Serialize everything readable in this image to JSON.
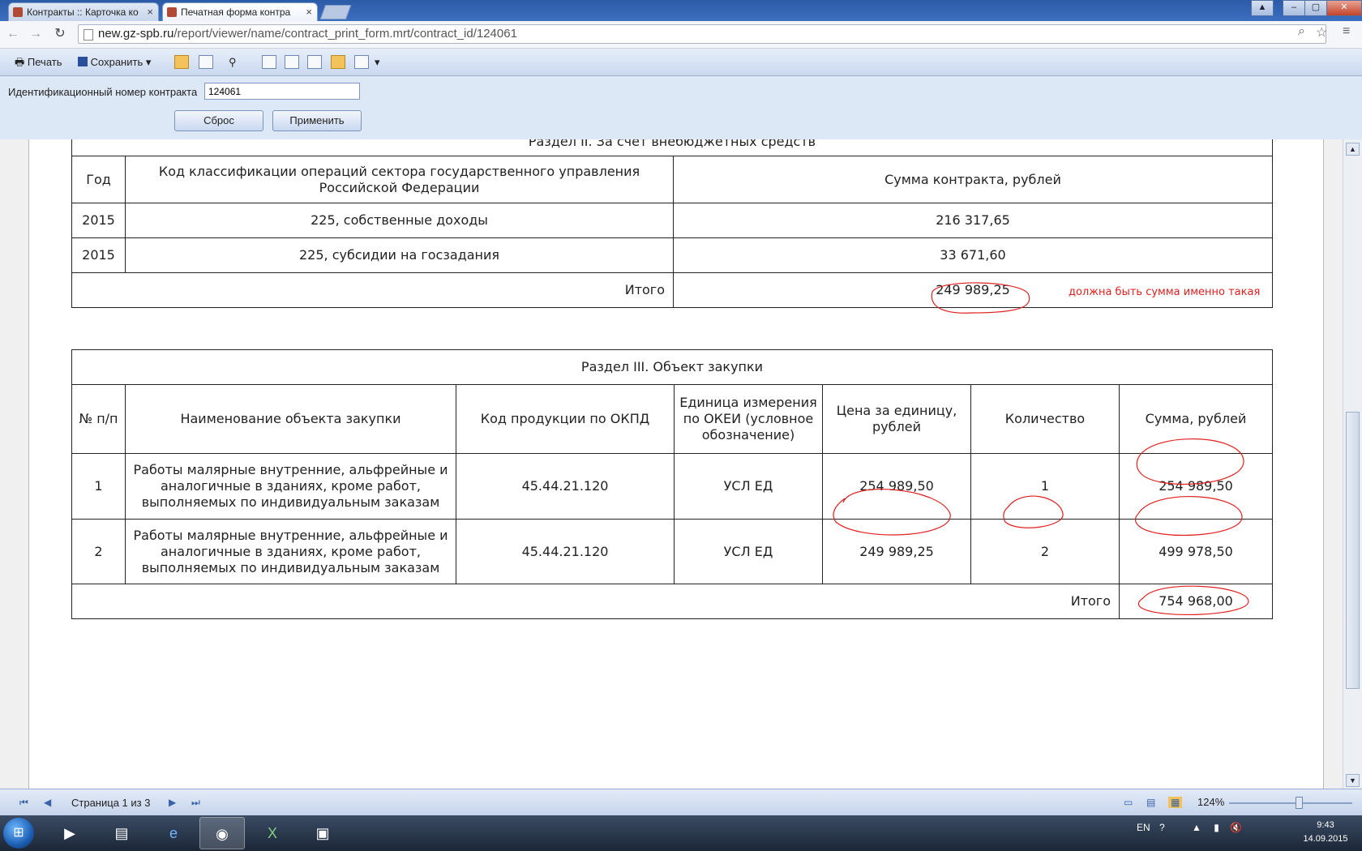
{
  "browser": {
    "tabs": [
      {
        "label": "Контракты :: Карточка ко"
      },
      {
        "label": "Печатная форма контра"
      }
    ],
    "url_host": "new.gz-spb.ru",
    "url_path": "/report/viewer/name/contract_print_form.mrt/contract_id/124061"
  },
  "toolbar": {
    "print_label": "Печать",
    "save_label": "Сохранить"
  },
  "params": {
    "label": "Идентификационный номер контракта",
    "value": "124061",
    "reset_label": "Сброс",
    "apply_label": "Применить"
  },
  "report": {
    "section2": {
      "title_fragment": "Раздел II. За счет внебюджетных средств",
      "headers": [
        "Год",
        "Код классификации операций сектора государственного управления Российской Федерации",
        "Сумма контракта, рублей"
      ],
      "rows": [
        [
          "2015",
          "225, собственные доходы",
          "216 317,65"
        ],
        [
          "2015",
          "225, субсидии на госзадания",
          "33 671,60"
        ]
      ],
      "total_label": "Итого",
      "total_value": "249 989,25"
    },
    "annotation": "должна быть сумма именно такая",
    "section3": {
      "title": "Раздел III. Объект закупки",
      "headers": [
        "№ п/п",
        "Наименование объекта закупки",
        "Код продукции по ОКПД",
        "Единица измерения по ОКЕИ (условное обозначение)",
        "Цена за единицу, рублей",
        "Количество",
        "Сумма, рублей"
      ],
      "rows": [
        [
          "1",
          "Работы малярные внутренние, альфрейные и аналогичные в зданиях, кроме работ, выполняемых по индивидуальным заказам",
          "45.44.21.120",
          "УСЛ ЕД",
          "254 989,50",
          "1",
          "254 989,50"
        ],
        [
          "2",
          "Работы малярные внутренние, альфрейные и аналогичные в зданиях, кроме работ, выполняемых по индивидуальным заказам",
          "45.44.21.120",
          "УСЛ ЕД",
          "249 989,25",
          "2",
          "499 978,50"
        ]
      ],
      "total_label": "Итого",
      "total_value": "754 968,00"
    }
  },
  "status": {
    "page_info": "Страница 1 из 3",
    "zoom": "124%"
  },
  "taskbar": {
    "lang": "EN",
    "time": "9:43",
    "date": "14.09.2015"
  },
  "colors": {
    "annotation_red": "#e02020"
  }
}
